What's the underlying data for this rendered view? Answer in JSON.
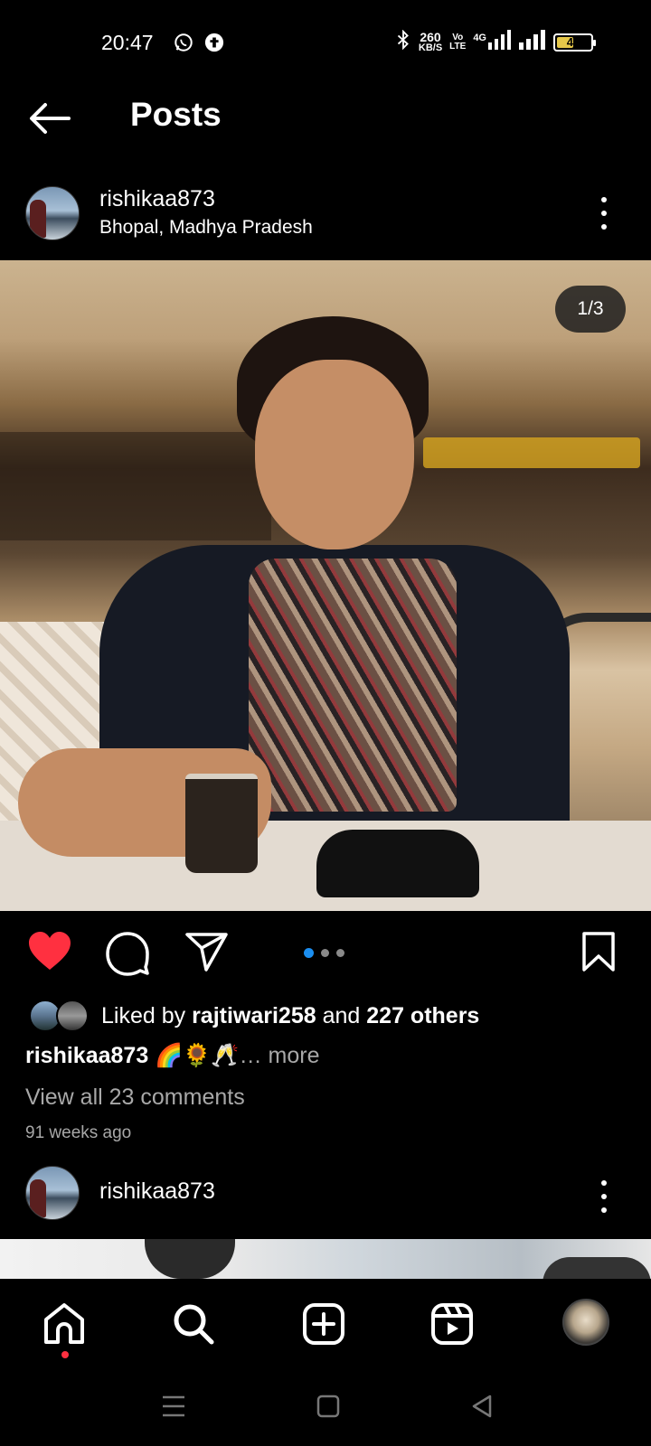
{
  "status_bar": {
    "time": "20:47",
    "net_speed_value": "260",
    "net_speed_unit": "KB/S",
    "volte_top": "Vo",
    "volte_bottom": "LTE",
    "network": "4G",
    "battery": "47"
  },
  "header": {
    "title": "Posts"
  },
  "post": {
    "username": "rishikaa873",
    "location": "Bhopal, Madhya Pradesh",
    "counter": "1/3",
    "carousel_total": 3,
    "carousel_active": 1,
    "liked_prefix": "Liked by ",
    "liked_user": "rajtiwari258",
    "liked_and": " and ",
    "liked_others": "227 others",
    "caption_user": "rishikaa873",
    "caption_emojis": "🌈🌻🥂",
    "caption_more": "… more",
    "comments_link": "View all 23 comments",
    "timestamp": "91 weeks ago",
    "liked": true,
    "like_color": "#ff3040"
  },
  "next_post": {
    "username": "rishikaa873"
  },
  "colors": {
    "background": "#000000",
    "text": "#ffffff",
    "muted": "#a8a8a8",
    "accent_blue": "#1b8ef0",
    "notification_dot": "#ff3040"
  },
  "icons": {
    "back": "arrow-left-icon",
    "more": "three-dots-vertical-icon",
    "like": "heart-filled-icon",
    "comment": "speech-bubble-icon",
    "share": "paper-plane-icon",
    "save": "bookmark-icon",
    "nav_home": "home-icon",
    "nav_search": "search-icon",
    "nav_create": "plus-square-icon",
    "nav_reels": "reels-icon"
  }
}
